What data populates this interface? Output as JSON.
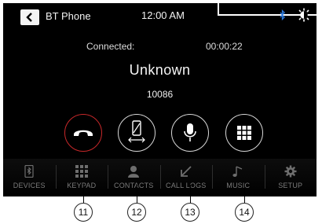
{
  "header": {
    "back_icon": "chevron-left-icon",
    "title": "BT Phone",
    "clock": "12:00 AM",
    "bt_icon": "bluetooth-icon",
    "brightness_icon": "brightness-icon"
  },
  "call": {
    "status_label": "Connected:",
    "timer": "00:00:22",
    "caller_name": "Unknown",
    "caller_number": "10086"
  },
  "actions": [
    {
      "icon": "hang-up-icon",
      "callout": "11",
      "color": "#c8282a"
    },
    {
      "icon": "phone-transfer-icon",
      "callout": "12"
    },
    {
      "icon": "microphone-icon",
      "callout": "13"
    },
    {
      "icon": "keypad-icon",
      "callout": "14"
    }
  ],
  "nav": [
    {
      "label": "DEVICES",
      "icon": "bt-device-icon"
    },
    {
      "label": "KEYPAD",
      "icon": "keypad-icon"
    },
    {
      "label": "CONTACTS",
      "icon": "contacts-icon"
    },
    {
      "label": "CALL LOGS",
      "icon": "call-logs-icon"
    },
    {
      "label": "MUSIC",
      "icon": "music-note-icon"
    },
    {
      "label": "SETUP",
      "icon": "gear-icon"
    }
  ],
  "colors": {
    "background": "#000000",
    "hangup": "#c8282a",
    "bluetooth": "#2f7de1",
    "nav_text": "#7b7b7b"
  }
}
